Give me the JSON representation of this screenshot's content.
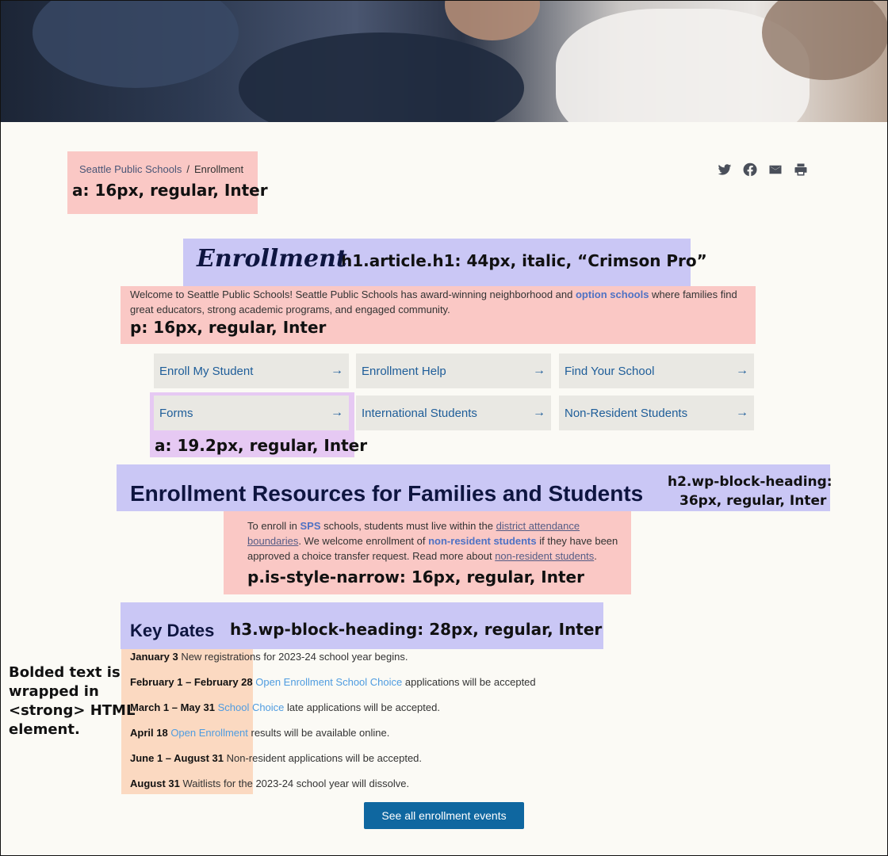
{
  "breadcrumb": {
    "home": "Seattle Public Schools",
    "separator": "/",
    "current": "Enrollment"
  },
  "share_icons": [
    "twitter-icon",
    "facebook-icon",
    "email-icon",
    "print-icon"
  ],
  "page_title": "Enrollment",
  "intro": {
    "before": "Welcome to Seattle Public Schools! Seattle Public Schools has award-winning neighborhood and ",
    "link": "option schools",
    "after": " where families find great educators, strong academic programs, and engaged community."
  },
  "tiles": [
    {
      "label": "Enroll My Student",
      "arrow": "→"
    },
    {
      "label": "Enrollment Help",
      "arrow": "→"
    },
    {
      "label": "Find Your School",
      "arrow": "→"
    },
    {
      "label": "Forms",
      "arrow": "→"
    },
    {
      "label": "International Students",
      "arrow": "→"
    },
    {
      "label": "Non-Resident Students",
      "arrow": "→"
    }
  ],
  "resources_heading": "Enrollment Resources for Families and Students",
  "resources_text": {
    "t1": "To enroll in ",
    "l1": "SPS",
    "t2": " schools, students must live within the ",
    "l2": "district attendance boundaries",
    "t3": ". We welcome enrollment of ",
    "l3": "non-resident students",
    "t4": " if they have been approved a choice transfer request. Read more about ",
    "l4": "non-resident students",
    "t5": "."
  },
  "key_dates_heading": "Key Dates",
  "key_dates": [
    {
      "date": "January 3",
      "link": "",
      "text": " New registrations for 2023-24 school year begins."
    },
    {
      "date": "February 1 – February 28",
      "link": "Open Enrollment School Choice",
      "text": " applications will be accepted"
    },
    {
      "date": "March 1 – May 31",
      "link": "School Choice",
      "text": " late applications will be accepted."
    },
    {
      "date": "April 18",
      "link": "Open Enrollment",
      "text": " results will be available online."
    },
    {
      "date": "June 1 – August 31",
      "link": "",
      "text": " Non-resident applications will be accepted."
    },
    {
      "date": "August 31",
      "link": "",
      "text": " Waitlists for the 2023-24 school year will dissolve."
    }
  ],
  "events_button": "See all enrollment events",
  "annotations": {
    "breadcrumb": "a: 16px, regular, Inter",
    "h1": "h1.article.h1: 44px, italic, “Crimson Pro”",
    "intro": "p: 16px, regular, Inter",
    "tile": "a: 19.2px, regular, Inter",
    "h2_line1": "h2.wp-block-heading:",
    "h2_line2": "36px, regular, Inter",
    "narrow": "p.is-style-narrow: 16px, regular, Inter",
    "h3": "h3.wp-block-heading: 28px, regular, Inter",
    "strong_note": [
      "Bolded text is",
      "wrapped in",
      "<strong> HTML",
      "element."
    ]
  },
  "colors": {
    "accent": "#0f67a0",
    "link": "#4f72c4",
    "heading": "#0e1540",
    "tile_bg": "#e9e8e3"
  }
}
